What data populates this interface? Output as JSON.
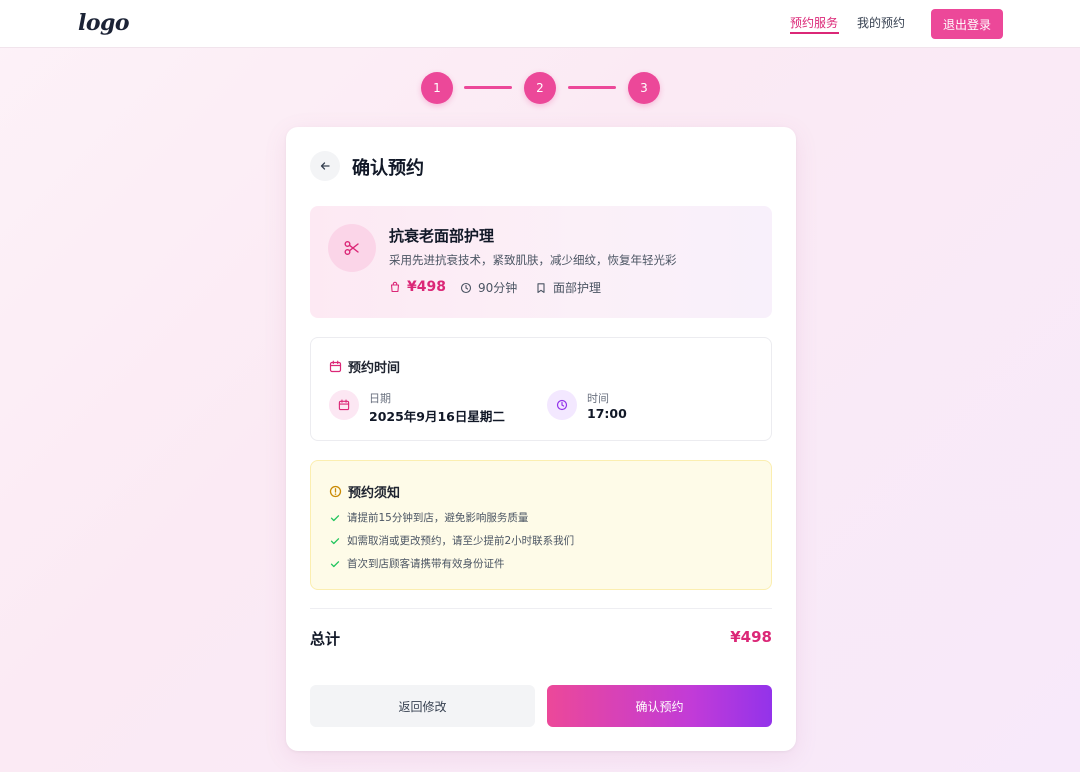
{
  "header": {
    "logo": "logo",
    "nav": [
      {
        "label": "预约服务",
        "active": true
      },
      {
        "label": "我的预约",
        "active": false
      }
    ],
    "logout_label": "退出登录"
  },
  "steps": [
    "1",
    "2",
    "3"
  ],
  "card": {
    "title": "确认预约",
    "service": {
      "name": "抗衰老面部护理",
      "description": "采用先进抗衰技术，紧致肌肤，减少细纹，恢复年轻光彩",
      "price": "¥498",
      "duration": "90分钟",
      "category": "面部护理",
      "icon": "scissors-icon"
    },
    "time": {
      "title": "预约时间",
      "date_label": "日期",
      "date_value": "2025年9月16日星期二",
      "time_label": "时间",
      "time_value": "17:00"
    },
    "notice": {
      "title": "预约须知",
      "items": [
        "请提前15分钟到店，避免影响服务质量",
        "如需取消或更改预约，请至少提前2小时联系我们",
        "首次到店顾客请携带有效身份证件"
      ]
    },
    "total_label": "总计",
    "total_value": "¥498",
    "back_label": "返回修改",
    "confirm_label": "确认预约"
  },
  "colors": {
    "accent": "#ec4899",
    "accent_dark": "#db2777",
    "purple": "#9333ea",
    "notice_bg": "#fefbe8",
    "check_green": "#22c55e"
  }
}
